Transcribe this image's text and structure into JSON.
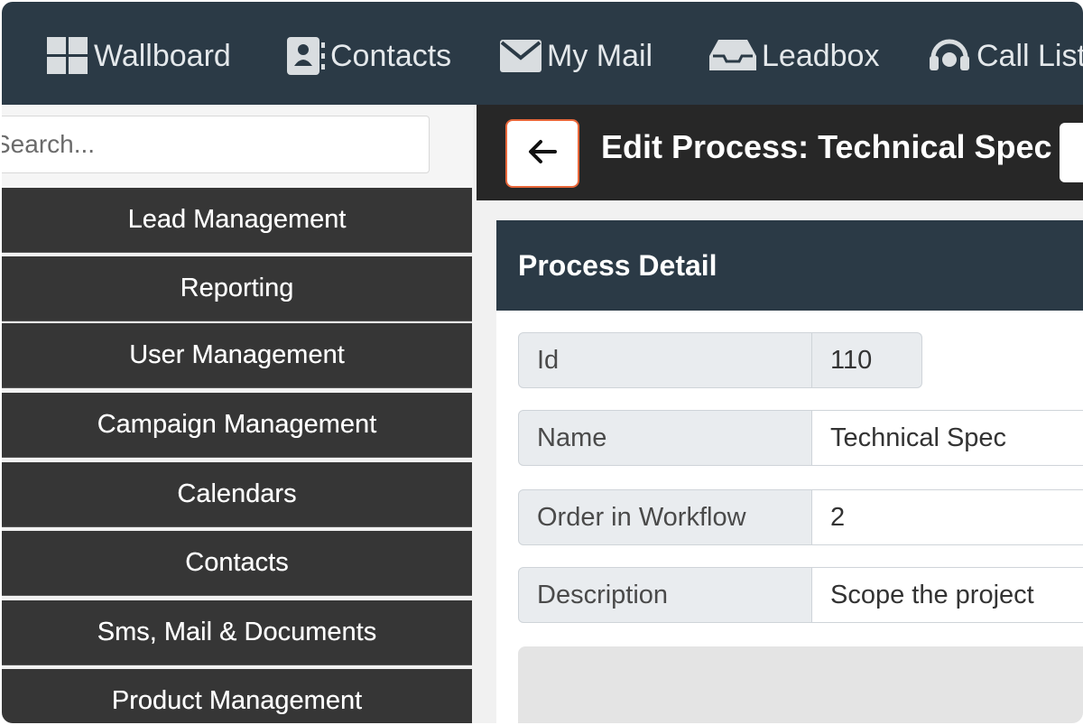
{
  "nav": {
    "items": [
      {
        "label": "Wallboard",
        "icon": "dashboard-grid-icon"
      },
      {
        "label": "Contacts",
        "icon": "contact-card-icon"
      },
      {
        "label": "My Mail",
        "icon": "envelope-icon"
      },
      {
        "label": "Leadbox",
        "icon": "inbox-tray-icon"
      },
      {
        "label": "Call List",
        "icon": "headset-icon"
      }
    ]
  },
  "sidebar": {
    "search_placeholder": "Search...",
    "items": [
      {
        "label": "Lead Management"
      },
      {
        "label": "Reporting"
      },
      {
        "label": "User Management"
      },
      {
        "label": "Campaign Management"
      },
      {
        "label": "Calendars"
      },
      {
        "label": "Contacts"
      },
      {
        "label": "Sms, Mail & Documents"
      },
      {
        "label": "Product Management"
      }
    ]
  },
  "header": {
    "back_icon": "arrow-left-icon",
    "title": "Edit Process: Technical Spec"
  },
  "panel": {
    "title": "Process Detail",
    "fields": [
      {
        "label": "Id",
        "value": "110"
      },
      {
        "label": "Name",
        "value": "Technical Spec"
      },
      {
        "label": "Order in Workflow",
        "value": "2"
      },
      {
        "label": "Description",
        "value": "Scope the project"
      }
    ]
  },
  "colors": {
    "nav_bg": "#2b3a46",
    "sidebar_item_bg": "#363636",
    "header_bg": "#272727",
    "highlight": "#e8673a"
  }
}
